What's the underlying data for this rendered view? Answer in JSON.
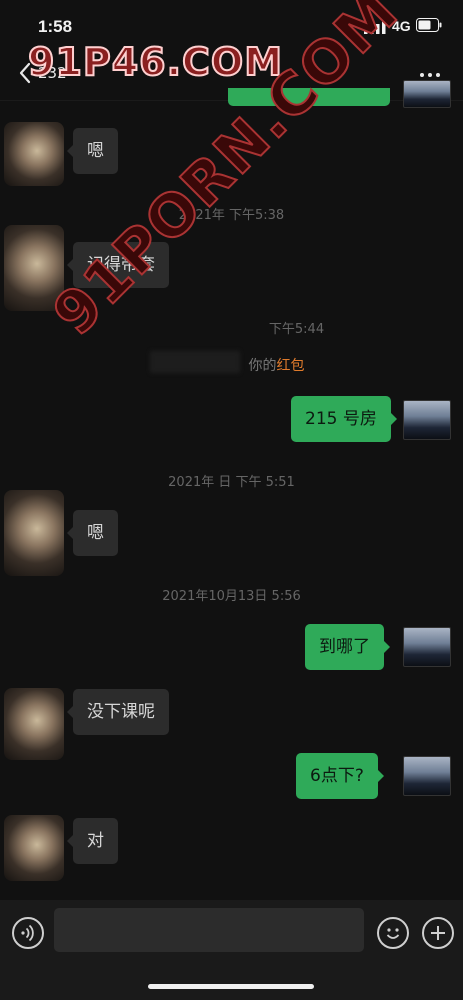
{
  "status_bar": {
    "time": "1:58",
    "network": "4G"
  },
  "nav": {
    "back_count": "232"
  },
  "watermarks": {
    "top": "91P46.COM",
    "diagonal": "91PORN.COM"
  },
  "messages": [
    {
      "side": "left",
      "text": "嗯"
    },
    {
      "timestamp": "2021年 下午5:38"
    },
    {
      "side": "left",
      "text": "记得带套"
    },
    {
      "timestamp": "下午5:44"
    },
    {
      "system": "你的",
      "highlight": "红包"
    },
    {
      "side": "right",
      "text": "215 号房"
    },
    {
      "timestamp": "2021年 日 下午 5:51"
    },
    {
      "side": "left",
      "text": "嗯"
    },
    {
      "timestamp": "2021年10月13日 5:56"
    },
    {
      "side": "right",
      "text": "到哪了"
    },
    {
      "side": "left",
      "text": "没下课呢"
    },
    {
      "side": "right",
      "text": "6点下?"
    },
    {
      "side": "left",
      "text": "对"
    }
  ],
  "icons": {
    "back": "chevron-left-icon",
    "more": "more-icon",
    "voice": "voice-icon",
    "emoji": "emoji-icon",
    "plus": "plus-icon"
  },
  "colors": {
    "bubble_sent": "#2faa59",
    "bubble_received": "#2c2c2c",
    "red_packet": "#e07b2c"
  }
}
